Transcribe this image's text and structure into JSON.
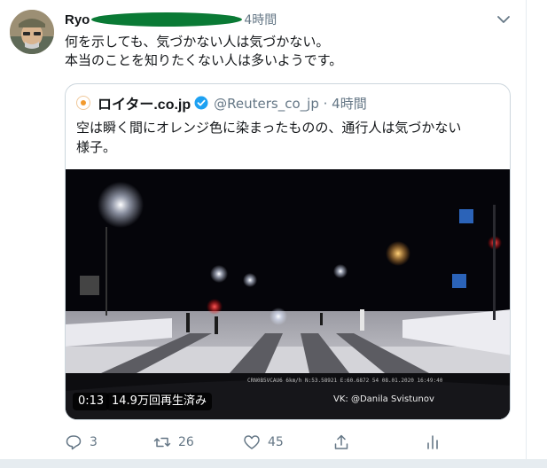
{
  "tweet": {
    "author_name": "Ryo",
    "time": "4時間",
    "text_line1": "何を示しても、気づかない人は気づかない。",
    "text_line2": "本当のことを知りたくない人は多いようです。"
  },
  "quoted": {
    "name": "ロイター.co.jp",
    "handle": "@Reuters_co_jp · 4時間",
    "text_line1": "空は瞬く間にオレンジ色に染まったものの、通行人は気づかない",
    "text_line2": "様子。",
    "video": {
      "duration": "0:13",
      "views": "14.9万回再生済み",
      "watermark": "VK: @Danila Svistunov"
    }
  },
  "actions": {
    "reply_count": "3",
    "retweet_count": "26",
    "like_count": "45"
  },
  "colors": {
    "secondary_text": "#657786",
    "verified_blue": "#1da1f2",
    "redaction_green": "#0a7a35"
  },
  "icons": [
    "avatar",
    "chevron-down-icon",
    "verified-icon",
    "reply-icon",
    "retweet-icon",
    "like-icon",
    "share-icon",
    "analytics-icon"
  ]
}
